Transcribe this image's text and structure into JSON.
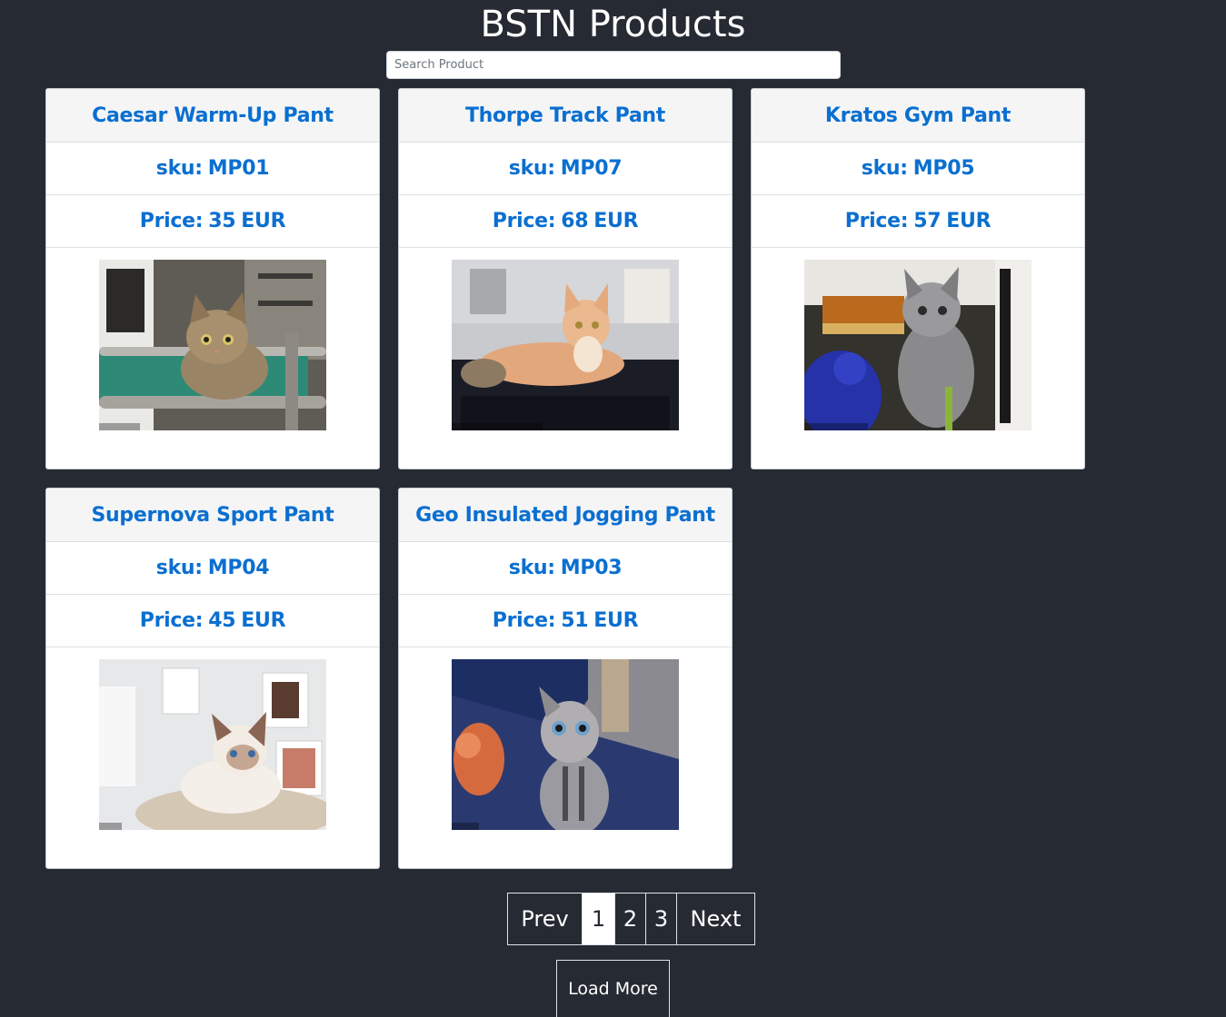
{
  "header": {
    "title": "BSTN Products"
  },
  "search": {
    "placeholder": "Search Product",
    "value": ""
  },
  "labels": {
    "sku_prefix": "sku:",
    "price_prefix": "Price:",
    "currency": "EUR"
  },
  "products": [
    {
      "name": "Caesar Warm-Up Pant",
      "sku": "MP01",
      "price": "35",
      "image": {
        "subject": "tabby kitten on a pet bed",
        "palette": [
          "#6c6a63",
          "#2e8a77",
          "#b59a78",
          "#3c3b38"
        ]
      }
    },
    {
      "name": "Thorpe Track Pant",
      "sku": "MP07",
      "price": "68",
      "image": {
        "subject": "cream kitten lying on a dark cushion",
        "palette": [
          "#c2c4ca",
          "#e8b38a",
          "#1b1d26",
          "#f1e4d8"
        ]
      }
    },
    {
      "name": "Kratos Gym Pant",
      "sku": "MP05",
      "price": "57",
      "image": {
        "subject": "grey fluffy kitten next to blue plush toy",
        "palette": [
          "#3b3a34",
          "#8c8c8e",
          "#2532a8",
          "#b96a1d"
        ]
      }
    },
    {
      "name": "Supernova Sport Pant",
      "sku": "MP04",
      "price": "45",
      "image": {
        "subject": "ragdoll kitten lying on a blanket",
        "palette": [
          "#e9eaec",
          "#f2efe9",
          "#8a6553",
          "#c7b9a5"
        ]
      }
    },
    {
      "name": "Geo Insulated Jogging Pant",
      "sku": "MP03",
      "price": "51",
      "image": {
        "subject": "tabby kitten looking up",
        "palette": [
          "#1d2e63",
          "#8a8a90",
          "#d66a3f",
          "#52648d"
        ]
      }
    }
  ],
  "pagination": {
    "prev_label": "Prev",
    "next_label": "Next",
    "pages": [
      "1",
      "2",
      "3"
    ],
    "current_page": "1"
  },
  "load_more_label": "Load More"
}
